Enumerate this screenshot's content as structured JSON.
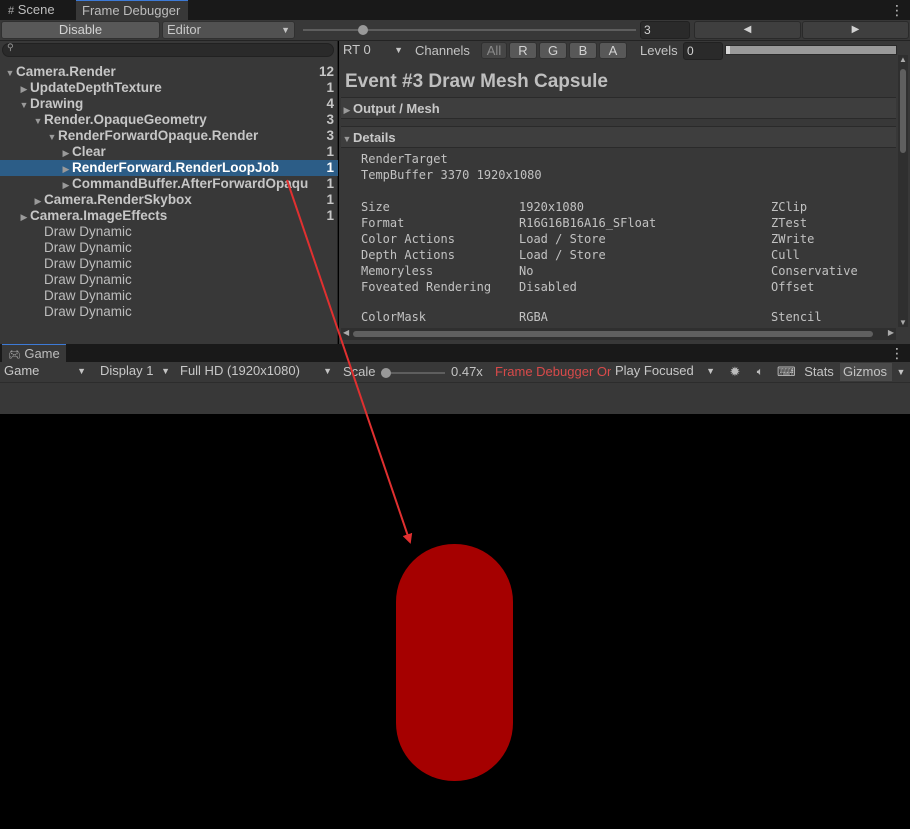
{
  "tabs": {
    "scene": "Scene",
    "frame_debugger": "Frame Debugger"
  },
  "toolbar": {
    "disable": "Disable",
    "target": "Editor",
    "event_index": "3"
  },
  "search": {
    "placeholder": ""
  },
  "tree": [
    {
      "label": "Camera.Render",
      "count": "12",
      "depth": 0,
      "expanded": true,
      "style": "bold"
    },
    {
      "label": "UpdateDepthTexture",
      "count": "1",
      "depth": 1,
      "expanded": false,
      "style": "bold"
    },
    {
      "label": "Drawing",
      "count": "4",
      "depth": 1,
      "expanded": true,
      "style": "bold"
    },
    {
      "label": "Render.OpaqueGeometry",
      "count": "3",
      "depth": 2,
      "expanded": true,
      "style": "bold"
    },
    {
      "label": "RenderForwardOpaque.Render",
      "count": "3",
      "depth": 3,
      "expanded": true,
      "style": "bold"
    },
    {
      "label": "Clear",
      "count": "1",
      "depth": 4,
      "expanded": false,
      "style": "bold"
    },
    {
      "label": "RenderForward.RenderLoopJob",
      "count": "1",
      "depth": 4,
      "expanded": false,
      "style": "selected"
    },
    {
      "label": "CommandBuffer.AfterForwardOpaqu",
      "count": "1",
      "depth": 4,
      "expanded": false,
      "style": "bold"
    },
    {
      "label": "Camera.RenderSkybox",
      "count": "1",
      "depth": 2,
      "expanded": false,
      "style": "bold"
    },
    {
      "label": "Camera.ImageEffects",
      "count": "1",
      "depth": 1,
      "expanded": false,
      "style": "bold"
    },
    {
      "label": "Draw Dynamic",
      "count": "",
      "depth": 2,
      "expanded": null,
      "style": "plain"
    },
    {
      "label": "Draw Dynamic",
      "count": "",
      "depth": 2,
      "expanded": null,
      "style": "plain"
    },
    {
      "label": "Draw Dynamic",
      "count": "",
      "depth": 2,
      "expanded": null,
      "style": "plain"
    },
    {
      "label": "Draw Dynamic",
      "count": "",
      "depth": 2,
      "expanded": null,
      "style": "plain"
    },
    {
      "label": "Draw Dynamic",
      "count": "",
      "depth": 2,
      "expanded": null,
      "style": "plain"
    },
    {
      "label": "Draw Dynamic",
      "count": "",
      "depth": 2,
      "expanded": null,
      "style": "plain"
    }
  ],
  "rt_bar": {
    "rt": "RT 0",
    "channels": "Channels",
    "channel_all": "All",
    "channel_r": "R",
    "channel_g": "G",
    "channel_b": "B",
    "channel_a": "A",
    "levels": "Levels",
    "levels_value": "0"
  },
  "event": {
    "title": "Event #3 Draw Mesh Capsule",
    "output_section": "Output / Mesh",
    "details_section": "Details",
    "render_target_label": "RenderTarget",
    "render_target_value": "TempBuffer 3370 1920x1080",
    "rows": [
      {
        "label": "Size",
        "value": "1920x1080",
        "right": "ZClip"
      },
      {
        "label": "Format",
        "value": "R16G16B16A16_SFloat",
        "right": "ZTest"
      },
      {
        "label": "Color Actions",
        "value": "Load / Store",
        "right": "ZWrite"
      },
      {
        "label": "Depth Actions",
        "value": "Load / Store",
        "right": "Cull"
      },
      {
        "label": "Memoryless",
        "value": "No",
        "right": "Conservative"
      },
      {
        "label": "Foveated Rendering",
        "value": "Disabled",
        "right": "Offset"
      }
    ],
    "colormask_label": "ColorMask",
    "colormask_value": "RGBA",
    "stencil_label": "Stencil"
  },
  "game": {
    "tab": "Game",
    "view": "Game",
    "display": "Display 1",
    "resolution": "Full HD (1920x1080)",
    "scale_label": "Scale",
    "scale_value": "0.47x",
    "frame_debugger_on": "Frame Debugger On",
    "play_focused": "Play Focused",
    "stats": "Stats",
    "gizmos": "Gizmos"
  },
  "colors": {
    "capsule": "#a50000",
    "annotation_arrow": "#e03030",
    "selection": "#2c5d87",
    "frame_debugger_on": "#d84a4a"
  }
}
